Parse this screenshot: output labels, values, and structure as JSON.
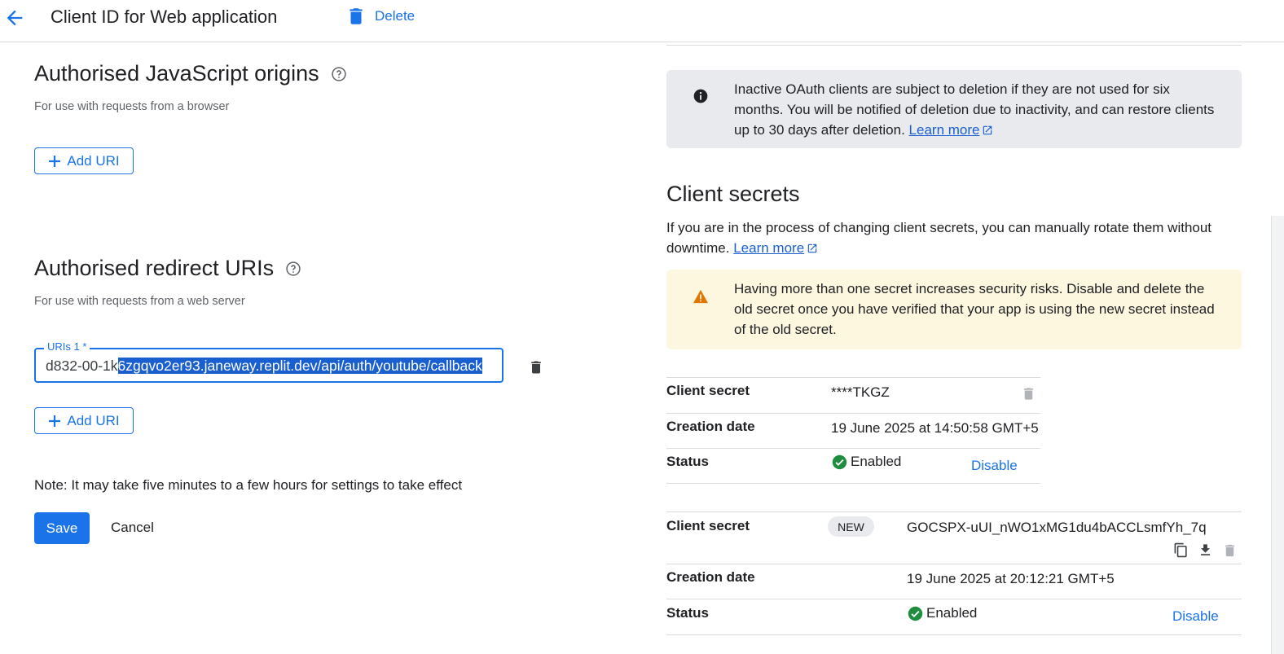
{
  "header": {
    "title": "Client ID for Web application",
    "delete_label": "Delete"
  },
  "js_origins": {
    "title": "Authorised JavaScript origins",
    "subtitle": "For use with requests from a browser",
    "add_uri_label": "Add URI"
  },
  "redirect_uris": {
    "title": "Authorised redirect URIs",
    "subtitle": "For use with requests from a web server",
    "field_label": "URIs 1 *",
    "value_unselected": "d832-00-1k",
    "value_selected": "6zgqvo2er93.janeway.replit.dev/api/auth/youtube/callback",
    "add_uri_label": "Add URI"
  },
  "form": {
    "note": "Note: It may take five minutes to a few hours for settings to take effect",
    "save_label": "Save",
    "cancel_label": "Cancel"
  },
  "info_notice": {
    "text": "Inactive OAuth clients are subject to deletion if they are not used for six months. You will be notified of deletion due to inactivity, and can restore clients up to 30 days after deletion.",
    "link": "Learn more"
  },
  "client_secrets": {
    "title": "Client secrets",
    "description": "If you are in the process of changing client secrets, you can manually rotate them without downtime.",
    "link": "Learn more",
    "warning": "Having more than one secret increases security risks. Disable and delete the old secret once you have verified that your app is using the new secret instead of the old secret.",
    "secrets": [
      {
        "secret_label": "Client secret",
        "secret_value": "****TKGZ",
        "creation_label": "Creation date",
        "creation_value": "19 June 2025 at 14:50:58 GMT+5",
        "status_label": "Status",
        "status_value": "Enabled",
        "action": "Disable"
      },
      {
        "secret_label": "Client secret",
        "badge": "NEW",
        "secret_value": "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",
        "creation_label": "Creation date",
        "creation_value": "19 June 2025 at 20:12:21 GMT+5",
        "status_label": "Status",
        "status_value": "Enabled",
        "action": "Disable"
      }
    ]
  },
  "colors": {
    "accent": "#1a73e8",
    "success": "#1e8e3e",
    "warning": "#e37400",
    "info_bg": "#e8eaed",
    "warning_bg": "#fef7e0"
  }
}
